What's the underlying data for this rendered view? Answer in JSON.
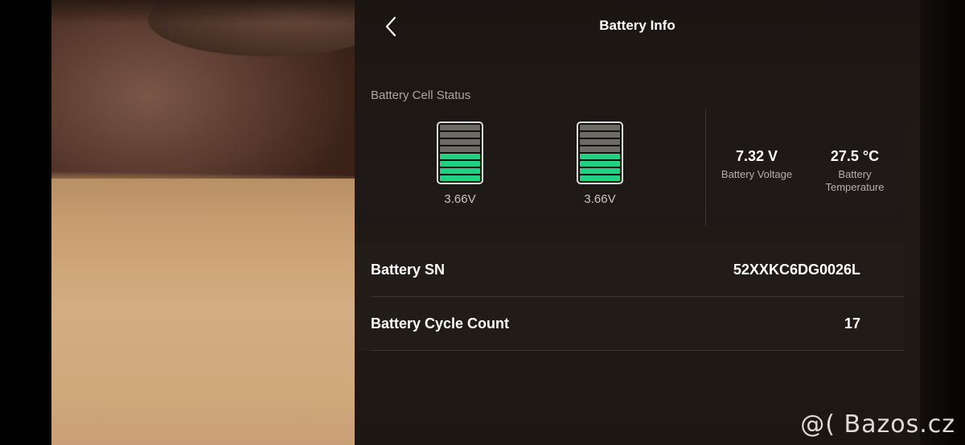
{
  "header": {
    "title": "Battery Info",
    "back_icon": "chevron-left-icon"
  },
  "cell_status": {
    "section_label": "Battery Cell Status",
    "cells": [
      {
        "voltage": "3.66V",
        "charge_fraction": 0.5
      },
      {
        "voltage": "3.66V",
        "charge_fraction": 0.5
      }
    ],
    "colors": {
      "charged": "#1fd180",
      "empty": "#6e6a66"
    }
  },
  "stats": {
    "voltage": {
      "value": "7.32 V",
      "label": "Battery Voltage"
    },
    "temperature": {
      "value": "27.5 °C",
      "label_line1": "Battery",
      "label_line2": "Temperature"
    }
  },
  "info_rows": {
    "sn": {
      "label": "Battery SN",
      "value": "52XXKC6DG0026L"
    },
    "cycle_count": {
      "label": "Battery Cycle Count",
      "value": "17"
    }
  },
  "watermark": "@( Bazos.cz"
}
